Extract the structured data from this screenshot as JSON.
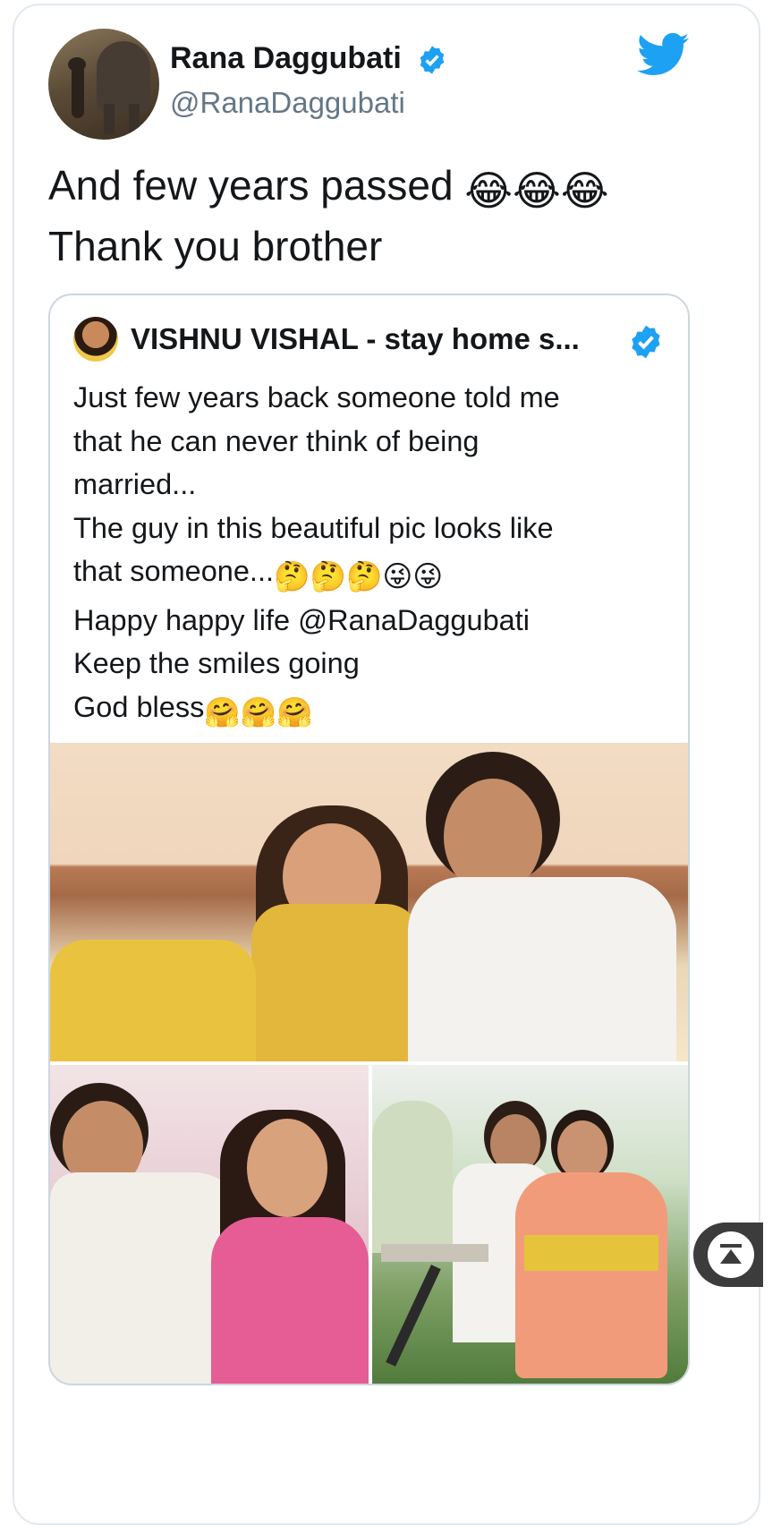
{
  "tweet": {
    "author_name": "Rana Daggubati",
    "author_handle": "@RanaDaggubati",
    "text_line1": "And few years passed",
    "text_line2": " Thank you brother",
    "emoji_line1": "😂😂😂",
    "accent_color": "#1da1f2"
  },
  "quoted_tweet": {
    "author_name": "VISHNU VISHAL - stay home s...",
    "lines": [
      "Just few years back someone told me",
      "that he can never think of being",
      "married...",
      "The guy in this beautiful pic looks like",
      "that someone...",
      "Happy happy life @RanaDaggubati",
      "Keep the smiles going",
      "God bless"
    ],
    "emoji_thinking": "🤔🤔🤔😜😜",
    "emoji_hug": "🤗🤗🤗"
  },
  "icons": {
    "verified": "verified-badge-icon",
    "twitter": "twitter-bird-icon",
    "scroll_top": "scroll-to-top-icon"
  }
}
